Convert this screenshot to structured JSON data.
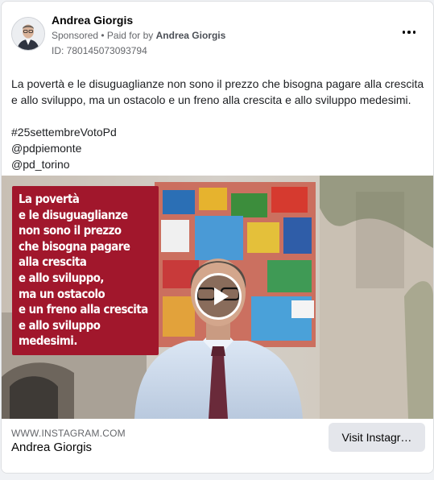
{
  "advertiser": {
    "name": "Andrea Giorgis",
    "sponsored": "Sponsored",
    "paid_for_prefix": " • Paid for by ",
    "paid_for_name": "Andrea Giorgis",
    "ad_id": "ID: 780145073093794"
  },
  "post": {
    "text": "La povertà e le disuguaglianze non sono il prezzo che bisogna pagare alla crescita e allo sviluppo, ma un ostacolo e un freno alla crescita e allo sviluppo medesimi.",
    "hashtag": "#25settembreVotoPd",
    "mention_1": "@pdpiemonte",
    "mention_2": "@pd_torino"
  },
  "media": {
    "overlay_lines": [
      "La povertà",
      "e le disuguaglianze",
      "non sono il prezzo",
      "che bisogna pagare",
      "alla crescita",
      "e allo sviluppo,",
      "ma un ostacolo",
      "e un freno alla crescita",
      "e allo sviluppo",
      "medesimi."
    ],
    "overlay_color": "#a1172c",
    "play_icon": "play-icon"
  },
  "footer": {
    "domain": "WWW.INSTAGRAM.COM",
    "title": "Andrea Giorgis",
    "cta_label": "Visit Instagr…"
  },
  "icons": {
    "more": "more-options-icon"
  }
}
